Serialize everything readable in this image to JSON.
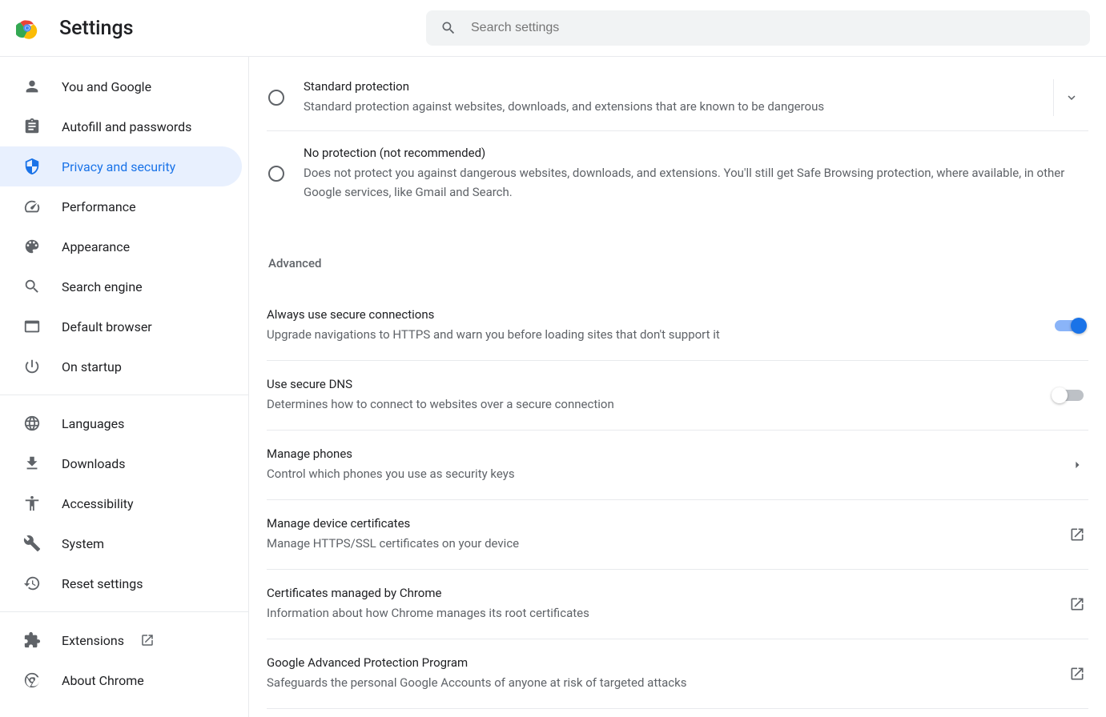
{
  "header": {
    "title": "Settings",
    "search_placeholder": "Search settings"
  },
  "sidebar": {
    "items": [
      {
        "label": "You and Google"
      },
      {
        "label": "Autofill and passwords"
      },
      {
        "label": "Privacy and security"
      },
      {
        "label": "Performance"
      },
      {
        "label": "Appearance"
      },
      {
        "label": "Search engine"
      },
      {
        "label": "Default browser"
      },
      {
        "label": "On startup"
      }
    ],
    "items2": [
      {
        "label": "Languages"
      },
      {
        "label": "Downloads"
      },
      {
        "label": "Accessibility"
      },
      {
        "label": "System"
      },
      {
        "label": "Reset settings"
      }
    ],
    "items3": [
      {
        "label": "Extensions"
      },
      {
        "label": "About Chrome"
      }
    ]
  },
  "main": {
    "radios": [
      {
        "title": "Standard protection",
        "desc": "Standard protection against websites, downloads, and extensions that are known to be dangerous",
        "expand": true
      },
      {
        "title": "No protection (not recommended)",
        "desc": "Does not protect you against dangerous websites, downloads, and extensions. You'll still get Safe Browsing protection, where available, in other Google services, like Gmail and Search."
      }
    ],
    "section": "Advanced",
    "rows": [
      {
        "title": "Always use secure connections",
        "desc": "Upgrade navigations to HTTPS and warn you before loading sites that don't support it",
        "toggle": true,
        "on": true
      },
      {
        "title": "Use secure DNS",
        "desc": "Determines how to connect to websites over a secure connection",
        "toggle": true,
        "on": false
      },
      {
        "title": "Manage phones",
        "desc": "Control which phones you use as security keys",
        "arrow": true
      },
      {
        "title": "Manage device certificates",
        "desc": "Manage HTTPS/SSL certificates on your device",
        "ext": true
      },
      {
        "title": "Certificates managed by Chrome",
        "desc": "Information about how Chrome manages its root certificates",
        "ext": true
      },
      {
        "title": "Google Advanced Protection Program",
        "desc": "Safeguards the personal Google Accounts of anyone at risk of targeted attacks",
        "ext": true
      }
    ]
  }
}
